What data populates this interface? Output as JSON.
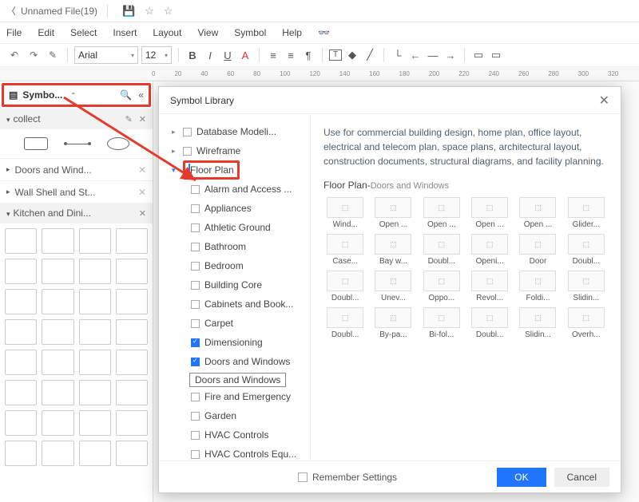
{
  "titlebar": {
    "file_title": "Unnamed File(19)"
  },
  "menu": [
    "File",
    "Edit",
    "Select",
    "Insert",
    "Layout",
    "View",
    "Symbol",
    "Help"
  ],
  "toolbar": {
    "font": "Arial",
    "size": "12"
  },
  "ruler_ticks": [
    "0",
    "20",
    "40",
    "60",
    "80",
    "100",
    "120",
    "140",
    "160",
    "180",
    "200",
    "220",
    "240",
    "260",
    "280",
    "300",
    "320"
  ],
  "sidebar": {
    "header": "Symbo...",
    "collect_label": "collect",
    "items": [
      {
        "label": "Doors and Wind..."
      },
      {
        "label": "Wall Shell and St..."
      },
      {
        "label": "Kitchen and Dini..."
      }
    ]
  },
  "dialog": {
    "title": "Symbol Library",
    "tree": {
      "top": [
        "Database Modeli...",
        "Wireframe"
      ],
      "floor_plan": "Floor Plan",
      "floor_children": [
        {
          "label": "Alarm and Access ...",
          "checked": false
        },
        {
          "label": "Appliances",
          "checked": false
        },
        {
          "label": "Athletic Ground",
          "checked": false
        },
        {
          "label": "Bathroom",
          "checked": false
        },
        {
          "label": "Bedroom",
          "checked": false
        },
        {
          "label": "Building Core",
          "checked": false
        },
        {
          "label": "Cabinets and Book...",
          "checked": false
        },
        {
          "label": "Carpet",
          "checked": false
        },
        {
          "label": "Dimensioning",
          "checked": true
        },
        {
          "label": "Doors and Windows",
          "checked": true
        },
        {
          "label": "Fire and Emergency",
          "checked": false
        },
        {
          "label": "Garden",
          "checked": false
        },
        {
          "label": "HVAC Controls",
          "checked": false
        },
        {
          "label": "HVAC Controls Equ...",
          "checked": false
        }
      ],
      "selected_sub": "Doors and Windows"
    },
    "description": "Use for commercial building design, home plan, office layout, electrical and telecom plan, space plans, architectural layout, construction documents, structural diagrams, and facility planning.",
    "section_main": "Floor Plan-",
    "section_sub": "Doors and Windows",
    "symbols": [
      "Wind...",
      "Open ...",
      "Open ...",
      "Open ...",
      "Open ...",
      "Glider...",
      "Case...",
      "Bay w...",
      "Doubl...",
      "Openi...",
      "Door",
      "Doubl...",
      "Doubl...",
      "Unev...",
      "Oppo...",
      "Revol...",
      "Foldi...",
      "Slidin...",
      "Doubl...",
      "By-pa...",
      "Bi-fol...",
      "Doubl...",
      "Slidin...",
      "Overh..."
    ],
    "remember": "Remember Settings",
    "ok": "OK",
    "cancel": "Cancel"
  }
}
